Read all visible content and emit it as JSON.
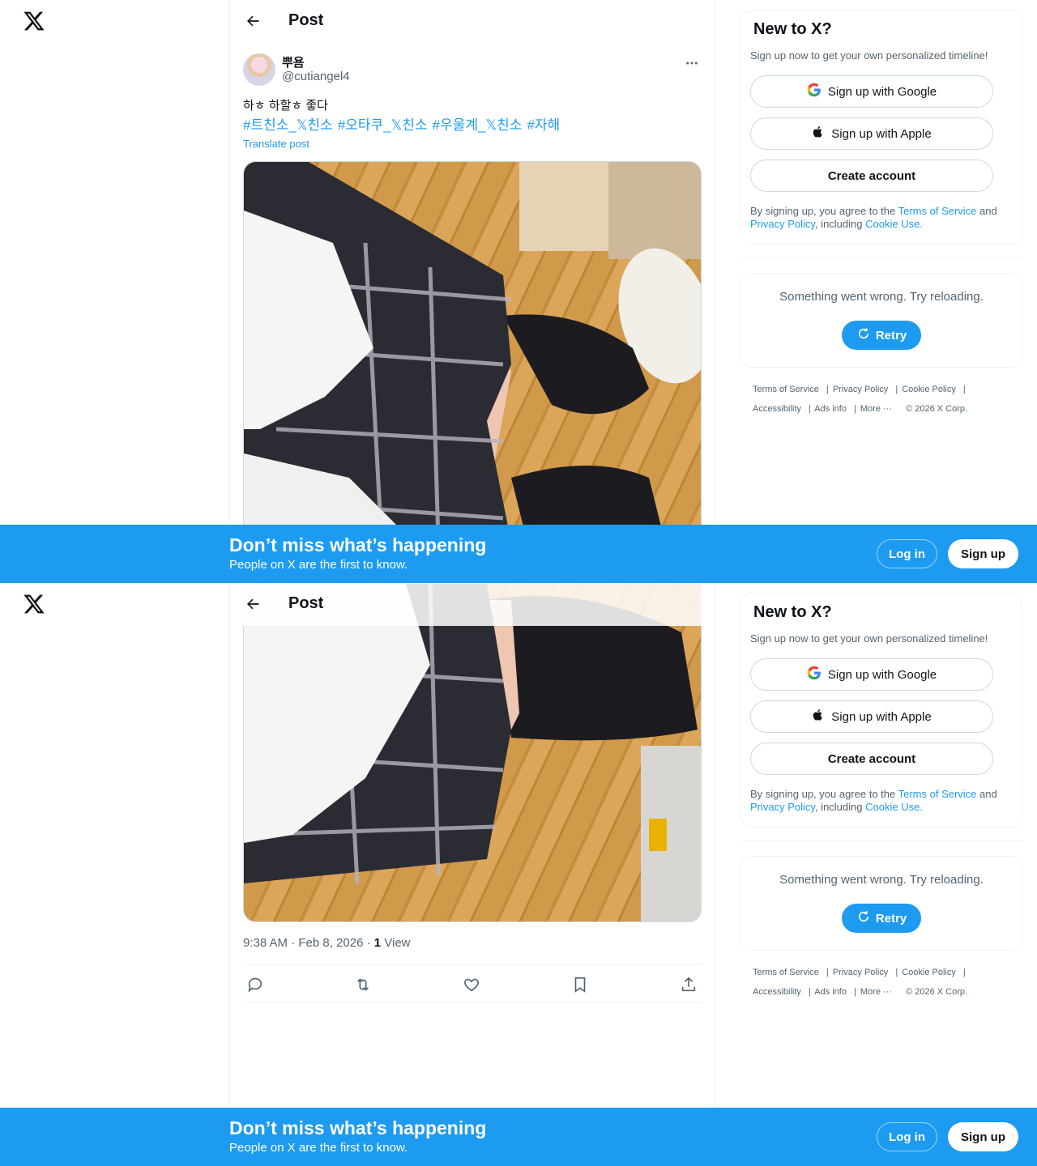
{
  "header": {
    "title": "Post"
  },
  "author": {
    "display_name": "뿌욤",
    "handle": "@cutiangel4"
  },
  "post": {
    "text": "하ㅎ 하할ㅎ 좋다",
    "hashtags": [
      "#트친소_𝕏친소",
      "#오타쿠_𝕏친소",
      "#우울계_𝕏친소",
      "#자해"
    ],
    "translate_label": "Translate post",
    "time": "9:38 AM · Feb 8, 2026 · ",
    "views_count": "1",
    "views_label": " View"
  },
  "sidebar": {
    "title": "New to X?",
    "subtitle": "Sign up now to get your own personalized timeline!",
    "google_label": "Sign up with Google",
    "apple_label": "Sign up with Apple",
    "create_label": "Create account",
    "legal_prefix": "By signing up, you agree to the ",
    "tos": "Terms of Service",
    "and": " and ",
    "privacy": "Privacy Policy",
    "including": ", including ",
    "cookie": "Cookie Use."
  },
  "error": {
    "text": "Something went wrong. Try reloading.",
    "retry_label": "Retry"
  },
  "footer": {
    "terms": "Terms of Service",
    "privacy": "Privacy Policy",
    "cookie": "Cookie Policy",
    "accessibility": "Accessibility",
    "ads": "Ads info",
    "more": "More ···",
    "copyright": "© 2026 X Corp."
  },
  "banner": {
    "title": "Don’t miss what’s happening",
    "subtitle": "People on X are the first to know.",
    "login_label": "Log in",
    "signup_label": "Sign up"
  },
  "colors": {
    "accent": "#1d9bf0",
    "text": "#0f1419",
    "muted": "#536471",
    "border": "#eff3f4"
  },
  "icons": [
    "x-logo-icon",
    "back-arrow-icon",
    "more-icon",
    "reply-icon",
    "repost-icon",
    "like-icon",
    "bookmark-icon",
    "share-icon",
    "google-icon",
    "apple-icon",
    "refresh-icon"
  ]
}
